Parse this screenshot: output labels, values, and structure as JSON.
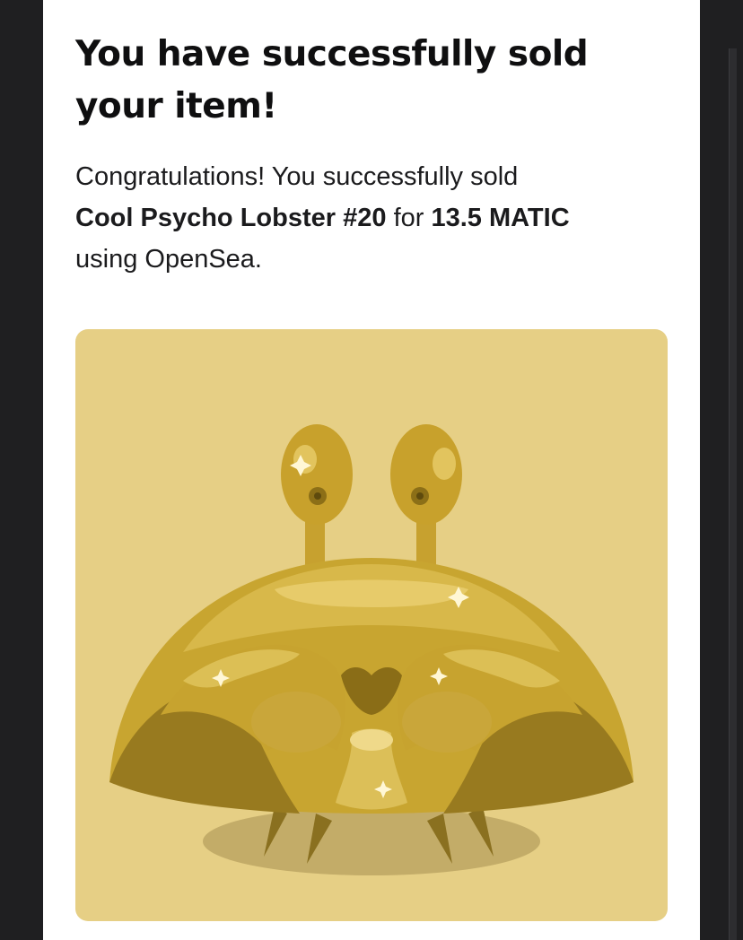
{
  "headline": "You have successfully sold your item!",
  "message": {
    "intro": "Congratulations! You successfully sold",
    "item_name": "Cool Psycho Lobster #20",
    "for_word": "for",
    "price": "13.5 MATIC",
    "outro": "using OpenSea."
  },
  "artwork": {
    "icon": "gold-crab-nft-icon",
    "background_color": "#e6cf85",
    "body_color": "#c8a530"
  }
}
